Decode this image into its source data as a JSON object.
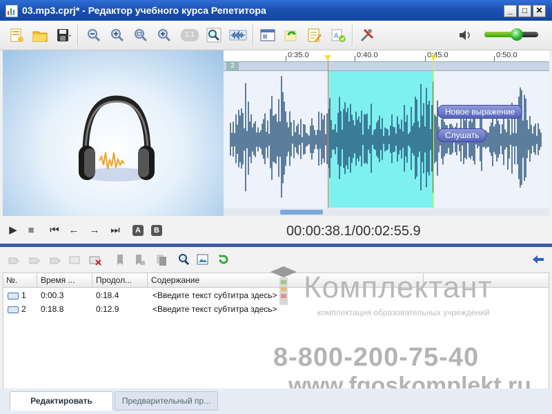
{
  "window": {
    "title": "03.mp3.cprj* - Редактор  учебного курса Репетитора",
    "minimize": "_",
    "maximize": "□",
    "close": "✕"
  },
  "toolbar": {
    "items": [
      "new-project-icon",
      "open-folder-icon",
      "save-icon",
      "zoom-out-icon",
      "zoom-in-icon",
      "zoom-selection-icon",
      "zoom-fit-icon",
      "zoom-1-1-icon",
      "zoom-magnify-icon",
      "waveform-icon",
      "window-icon",
      "refresh-icon",
      "edit-note-icon",
      "translate-icon",
      "settings-icon"
    ],
    "zoom_1_1_label": "1:1",
    "volume_icon": "speaker-icon",
    "volume_level": 0.6
  },
  "waveform": {
    "ruler_labels": [
      "0:35.0",
      "0:40.0",
      "0:45.0",
      "0:50.0"
    ],
    "track_number": "2",
    "context_menu": {
      "new_phrase": "Новое выражение",
      "listen": "Слушать"
    },
    "colors": {
      "selection": "#7ff0f0",
      "wave": "#1d4b73",
      "cursor": "#f0f020"
    }
  },
  "transport": {
    "play": "▶",
    "stop": "■",
    "prev": "⏮",
    "back": "←",
    "forward": "→",
    "next": "⏭",
    "marker_a": "A",
    "marker_b": "B",
    "time": "00:00:38.1/00:02:55.9"
  },
  "subtitles": {
    "columns": [
      "№.",
      "Время ...",
      "Продол...",
      "Содержание"
    ],
    "rows": [
      {
        "num": "1",
        "time": "0:00.3",
        "duration": "0:18.4",
        "content": "<Введите текст субтитра здесь>"
      },
      {
        "num": "2",
        "time": "0:18.8",
        "duration": "0:12.9",
        "content": "<Введите текст субтитра здесь>"
      }
    ]
  },
  "watermark": {
    "name": "Комплектант",
    "tagline": "комплектация образовательных учреждений",
    "phone": "8-800-200-75-40",
    "site": "www.fgoskomplekt.ru"
  },
  "tabs": {
    "edit": "Редактировать",
    "preview": "Предварительный пр..."
  }
}
